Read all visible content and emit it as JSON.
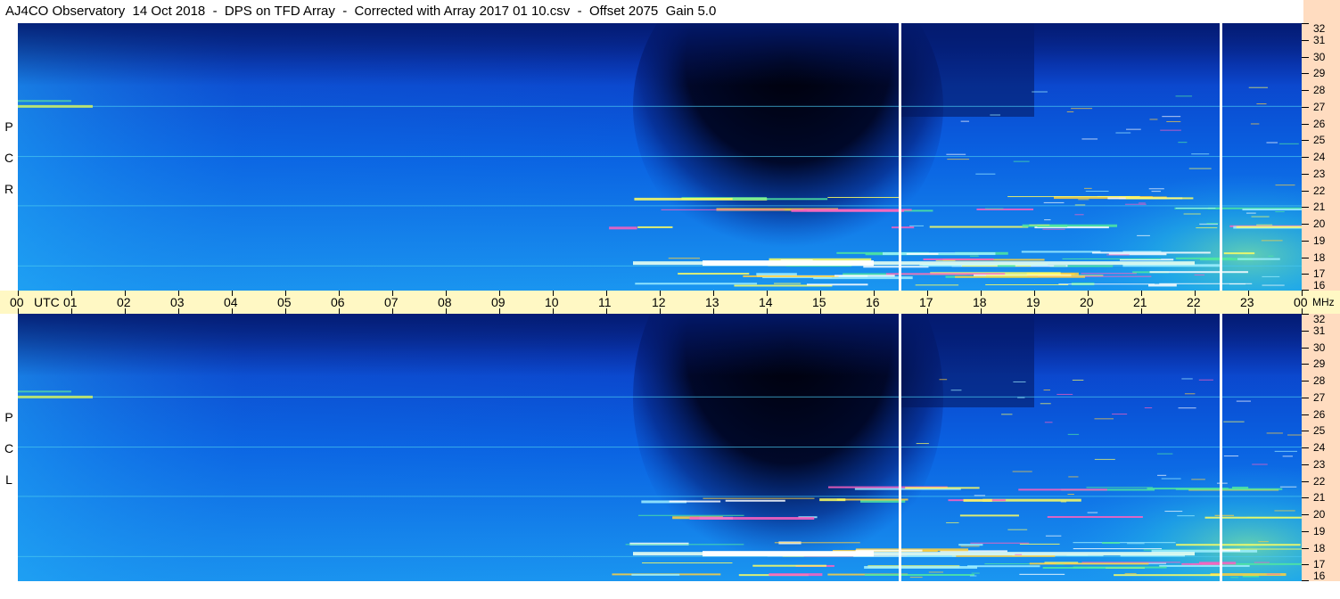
{
  "title": "AJ4CO Observatory  14 Oct 2018  -  DPS on TFD Array  -  Corrected with Array 2017 01 10.csv  -  Offset 2075  Gain 5.0",
  "chart_data": {
    "type": "heatmap",
    "title": "AJ4CO Observatory  14 Oct 2018  -  DPS on TFD Array  -  Corrected with Array 2017 01 10.csv  -  Offset 2075  Gain 5.0",
    "x_axis": {
      "unit_label": "UTC",
      "range": [
        0,
        24
      ],
      "tick_labels": [
        "00",
        "01",
        "02",
        "03",
        "04",
        "05",
        "06",
        "07",
        "08",
        "09",
        "10",
        "11",
        "12",
        "13",
        "14",
        "15",
        "16",
        "17",
        "18",
        "19",
        "20",
        "21",
        "22",
        "23",
        "00"
      ]
    },
    "y_axis": {
      "unit_label": "MHz",
      "range": [
        16,
        32
      ],
      "tick_labels": [
        "32",
        "31",
        "30",
        "29",
        "28",
        "27",
        "26",
        "25",
        "24",
        "23",
        "22",
        "21",
        "20",
        "19",
        "18",
        "17",
        "16"
      ]
    },
    "panels": [
      {
        "name": "R C P",
        "letters": [
          "R",
          "C",
          "P"
        ]
      },
      {
        "name": "L C P",
        "letters": [
          "L",
          "C",
          "P"
        ]
      }
    ],
    "colormap": [
      "#000010",
      "#001a6e",
      "#0038c8",
      "#0a78f0",
      "#1eb4f5",
      "#50e8b4",
      "#c8f050",
      "#ffffff"
    ],
    "grid": false
  },
  "axis_text": {
    "utc_label": "UTC",
    "mhz_label": "MHz"
  }
}
